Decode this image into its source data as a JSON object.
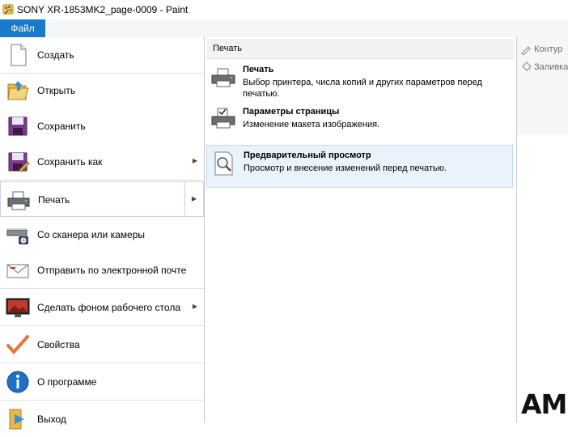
{
  "window": {
    "title": "SONY XR-1853MK2_page-0009 - Paint"
  },
  "ribbon": {
    "file_tab": "Файл",
    "commands": [
      {
        "label": "Контур",
        "icon": "outline-brush-icon"
      },
      {
        "label": "Заливка",
        "icon": "fill-icon"
      }
    ]
  },
  "menu": {
    "items": [
      {
        "label": "Создать",
        "icon": "new-document-icon",
        "has_arrow": false
      },
      {
        "label": "Открыть",
        "icon": "open-folder-icon",
        "has_arrow": false
      },
      {
        "label": "Сохранить",
        "icon": "save-disk-icon",
        "has_arrow": false
      },
      {
        "label": "Сохранить как",
        "icon": "save-as-icon",
        "has_arrow": true
      },
      {
        "label": "Печать",
        "icon": "printer-icon",
        "has_arrow": true,
        "selected": true
      },
      {
        "label": "Со сканера или камеры",
        "icon": "scanner-icon",
        "has_arrow": false
      },
      {
        "label": "Отправить по электронной почте",
        "icon": "email-icon",
        "has_arrow": false
      },
      {
        "label": "Сделать фоном рабочего стола",
        "icon": "desktop-background-icon",
        "has_arrow": true
      },
      {
        "label": "Свойства",
        "icon": "checkmark-icon",
        "has_arrow": false
      },
      {
        "label": "О программе",
        "icon": "info-icon",
        "has_arrow": false
      },
      {
        "label": "Выход",
        "icon": "exit-icon",
        "has_arrow": false
      }
    ]
  },
  "print_panel": {
    "header": "Печать",
    "items": [
      {
        "title": "Печать",
        "description": "Выбор принтера, числа копий и других параметров перед печатью.",
        "icon": "printer-icon"
      },
      {
        "title": "Параметры страницы",
        "description": "Изменение макета изображения.",
        "icon": "page-setup-icon"
      },
      {
        "title": "Предварительный просмотр",
        "description": "Просмотр и внесение изменений перед печатью.",
        "icon": "print-preview-icon",
        "highlighted": true
      }
    ]
  },
  "overlay_text": "AM",
  "colors": {
    "accent": "#1979ca",
    "highlight": "#eaf3fc",
    "highlight_border": "#c2dbf0"
  }
}
